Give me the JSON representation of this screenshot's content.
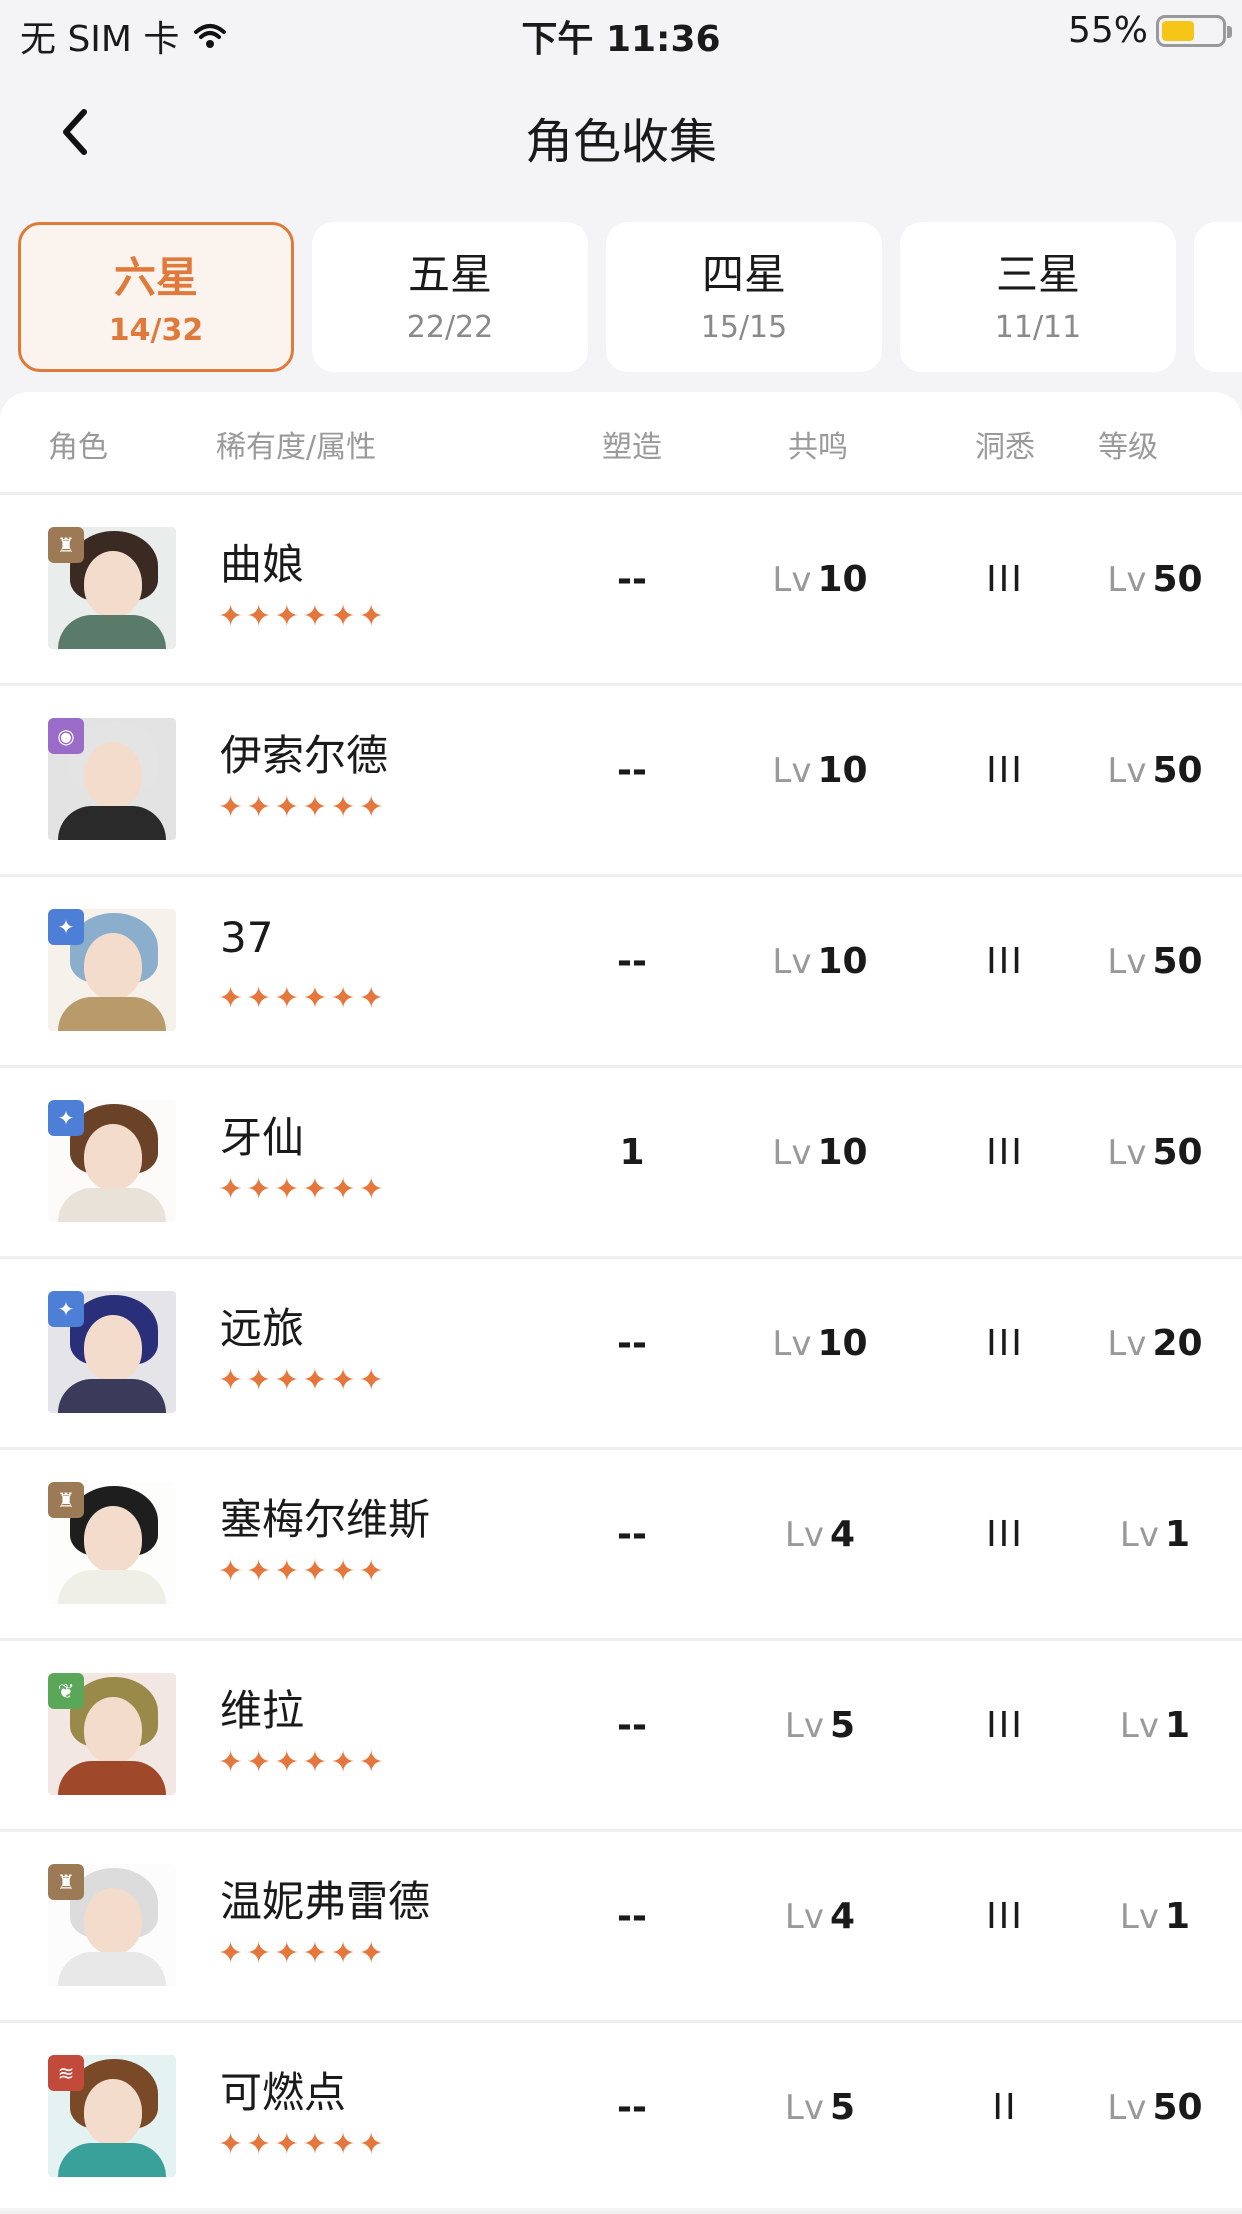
{
  "status_bar": {
    "carrier": "无 SIM 卡",
    "time": "下午 11:36",
    "battery_percent": "55%",
    "battery_level": 0.55
  },
  "nav": {
    "title": "角色收集"
  },
  "tabs": [
    {
      "label": "六星",
      "count": "14/32",
      "active": true
    },
    {
      "label": "五星",
      "count": "22/22",
      "active": false
    },
    {
      "label": "四星",
      "count": "15/15",
      "active": false
    },
    {
      "label": "三星",
      "count": "11/11",
      "active": false
    }
  ],
  "table": {
    "headers": {
      "role": "角色",
      "rarity": "稀有度/属性",
      "shape": "塑造",
      "resonance": "共鸣",
      "insight": "洞悉",
      "level": "等级"
    },
    "lv_prefix": "Lv",
    "stars": "✦✦✦✦✦✦",
    "rows": [
      {
        "name": "曲娘",
        "shape": "--",
        "resonance": "10",
        "insight": "III",
        "level": "50",
        "element": "beast",
        "element_color": "#9c7a55",
        "hair": "#3a2a22",
        "outfit": "#5a7a6a"
      },
      {
        "name": "伊索尔德",
        "shape": "--",
        "resonance": "10",
        "insight": "III",
        "level": "50",
        "element": "spirit",
        "element_color": "#9a6cc8",
        "hair": "#e4e4e4",
        "outfit": "#2a2a2a"
      },
      {
        "name": "37",
        "shape": "--",
        "resonance": "10",
        "insight": "III",
        "level": "50",
        "element": "star",
        "element_color": "#4e7fd6",
        "hair": "#8aaecc",
        "outfit": "#b99a6a"
      },
      {
        "name": "牙仙",
        "shape": "1",
        "resonance": "10",
        "insight": "III",
        "level": "50",
        "element": "star",
        "element_color": "#4e7fd6",
        "hair": "#6a4228",
        "outfit": "#e9e2d8"
      },
      {
        "name": "远旅",
        "shape": "--",
        "resonance": "10",
        "insight": "III",
        "level": "20",
        "element": "star",
        "element_color": "#4e7fd6",
        "hair": "#2a2f7a",
        "outfit": "#3a3a5a"
      },
      {
        "name": "塞梅尔维斯",
        "shape": "--",
        "resonance": "4",
        "insight": "III",
        "level": "1",
        "element": "beast",
        "element_color": "#9c7a55",
        "hair": "#1e1e1e",
        "outfit": "#efefe8"
      },
      {
        "name": "维拉",
        "shape": "--",
        "resonance": "5",
        "insight": "III",
        "level": "1",
        "element": "plant",
        "element_color": "#5aa75a",
        "hair": "#9a8a4a",
        "outfit": "#a0482a"
      },
      {
        "name": "温妮弗雷德",
        "shape": "--",
        "resonance": "4",
        "insight": "III",
        "level": "1",
        "element": "beast",
        "element_color": "#9c7a55",
        "hair": "#dcdcdc",
        "outfit": "#e8e8e8"
      },
      {
        "name": "可燃点",
        "shape": "--",
        "resonance": "5",
        "insight": "II",
        "level": "50",
        "element": "fire",
        "element_color": "#c24a3a",
        "hair": "#7a4a28",
        "outfit": "#3aa09a"
      }
    ]
  }
}
